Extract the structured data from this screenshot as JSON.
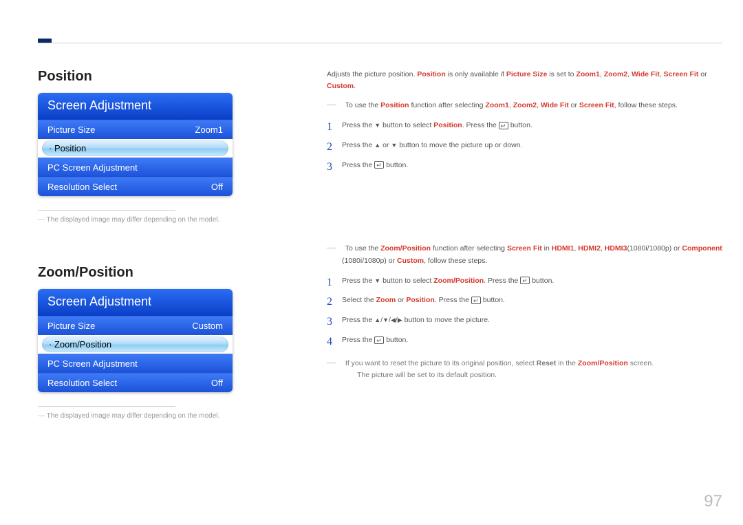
{
  "page_number": "97",
  "section1": {
    "title": "Position",
    "menu": {
      "header": "Screen Adjustment",
      "rows": [
        {
          "label": "Picture Size",
          "value": "Zoom1",
          "selected": false
        },
        {
          "label": "Position",
          "value": "",
          "selected": true,
          "dotted": true
        },
        {
          "label": "PC Screen Adjustment",
          "value": "",
          "selected": false
        },
        {
          "label": "Resolution Select",
          "value": "Off",
          "selected": false
        }
      ]
    },
    "note": "The displayed image may differ depending on the model.",
    "intro": {
      "pre": "Adjusts the picture position. ",
      "pos": "Position",
      "mid": " is only available if ",
      "ps": "Picture Size",
      "mid2": " is set to ",
      "opts": [
        "Zoom1",
        "Zoom2",
        "Wide Fit",
        "Screen Fit",
        "Custom"
      ],
      "end": "."
    },
    "dash": {
      "pre": "To use the ",
      "fn": "Position",
      "mid": " function after selecting ",
      "opts": [
        "Zoom1",
        "Zoom2",
        "Wide Fit",
        "Screen Fit"
      ],
      "end": ", follow these steps."
    },
    "steps": {
      "s1a": "Press the ",
      "s1b": " button to select ",
      "s1c": "Position",
      "s1d": ". Press the ",
      "s1e": " button.",
      "s2a": "Press the ",
      "s2b": " or ",
      "s2c": " button to move the picture up or down.",
      "s3a": "Press the ",
      "s3b": " button."
    }
  },
  "section2": {
    "title": "Zoom/Position",
    "menu": {
      "header": "Screen Adjustment",
      "rows": [
        {
          "label": "Picture Size",
          "value": "Custom",
          "selected": false
        },
        {
          "label": "Zoom/Position",
          "value": "",
          "selected": true,
          "dotted": true
        },
        {
          "label": "PC Screen Adjustment",
          "value": "",
          "selected": false
        },
        {
          "label": "Resolution Select",
          "value": "Off",
          "selected": false
        }
      ]
    },
    "note": "The displayed image may differ depending on the model.",
    "dash": {
      "pre": "To use the ",
      "fn": "Zoom/Position",
      "mid": " function after selecting ",
      "sf": "Screen Fit",
      "in": " in ",
      "h1": "HDMI1",
      "h2": "HDMI2",
      "h3": "HDMI3",
      "res": "(1080i/1080p) or ",
      "comp": "Component",
      "res2": " (1080i/1080p) or ",
      "cust": "Custom",
      "end": ", follow these steps."
    },
    "steps": {
      "s1a": "Press the ",
      "s1b": " button to select ",
      "s1c": "Zoom/Position",
      "s1d": ". Press the ",
      "s1e": " button.",
      "s2a": "Select the ",
      "s2b": "Zoom",
      "s2c": " or ",
      "s2d": "Position",
      "s2e": ". Press the ",
      "s2f": " button.",
      "s3a": "Press the ",
      "s3b": " button to move the picture.",
      "s4a": "Press the ",
      "s4b": " button."
    },
    "subnote": {
      "a": "If you want to reset the picture to its original position, select ",
      "b": "Reset",
      "c": " in the ",
      "d": "Zoom/Position",
      "e": " screen.",
      "f": "The picture will be set to its default position."
    }
  }
}
